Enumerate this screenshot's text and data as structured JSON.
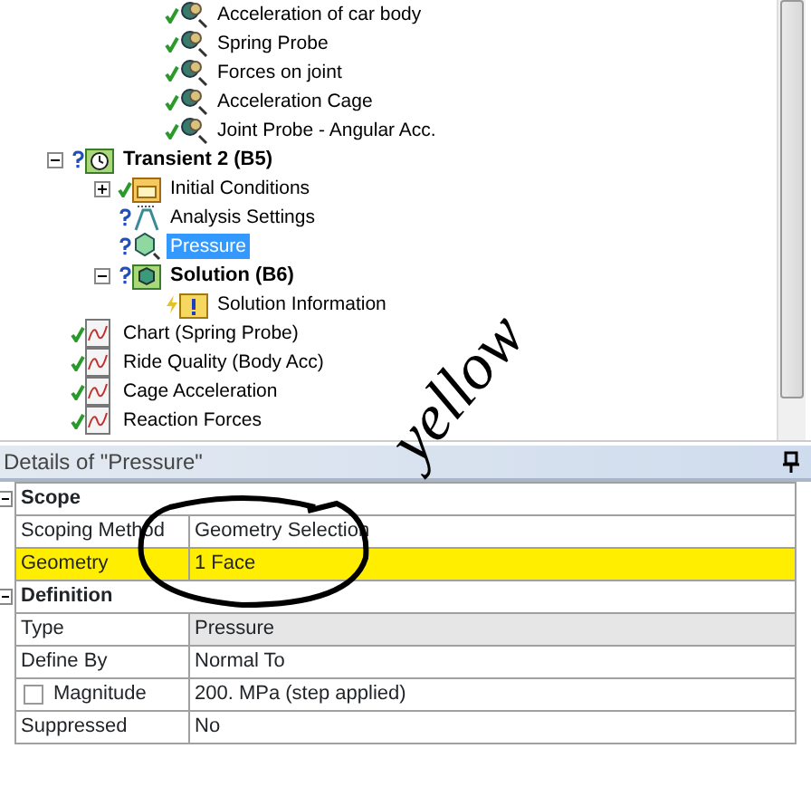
{
  "tree_upper_items": [
    {
      "label": "Acceleration of car body",
      "kind": "probe",
      "solved": true,
      "outdated": false
    },
    {
      "label": "Spring Probe",
      "kind": "probe",
      "solved": true,
      "outdated": false
    },
    {
      "label": "Forces on joint",
      "kind": "probe",
      "solved": true,
      "outdated": false
    },
    {
      "label": "Acceleration Cage",
      "kind": "probe",
      "solved": true,
      "outdated": false
    },
    {
      "label": "Joint Probe - Angular Acc.",
      "kind": "probe",
      "solved": true,
      "outdated": false
    }
  ],
  "tree": [
    {
      "label": "Transient 2 (B5)",
      "kind": "analysis",
      "solved": false,
      "outdated": false,
      "selected": false,
      "expanded": true,
      "children": [
        {
          "label": "Initial Conditions",
          "kind": "initial",
          "solved": true,
          "outdated": false,
          "selected": false,
          "expanded": false
        },
        {
          "label": "Analysis Settings",
          "kind": "settings",
          "solved": false,
          "outdated": false,
          "selected": false
        },
        {
          "label": "Pressure",
          "kind": "load",
          "solved": false,
          "outdated": false,
          "selected": true
        },
        {
          "label": "Solution (B6)",
          "kind": "solution",
          "solved": false,
          "outdated": false,
          "selected": false,
          "expanded": true,
          "children": [
            {
              "label": "Solution Information",
              "kind": "info",
              "solved": false,
              "outdated": true,
              "selected": false
            }
          ]
        }
      ]
    },
    {
      "label": "Chart (Spring Probe)",
      "kind": "chart",
      "solved": true,
      "outdated": false,
      "selected": false
    },
    {
      "label": "Ride Quality (Body Acc)",
      "kind": "chart",
      "solved": true,
      "outdated": false,
      "selected": false
    },
    {
      "label": "Cage Acceleration",
      "kind": "chart",
      "solved": true,
      "outdated": false,
      "selected": false
    },
    {
      "label": "Reaction Forces",
      "kind": "chart",
      "solved": true,
      "outdated": false,
      "selected": false
    }
  ],
  "details": {
    "title": "Details of \"Pressure\"",
    "sections": [
      {
        "label": "Scope",
        "expanded": true,
        "rows": [
          {
            "label": "Scoping Method",
            "value": "Geometry Selection",
            "highlighted": false,
            "readonly": false
          },
          {
            "label": "Geometry",
            "value": "1 Face",
            "highlighted": true,
            "readonly": false
          }
        ]
      },
      {
        "label": "Definition",
        "expanded": true,
        "rows": [
          {
            "label": "Type",
            "value": "Pressure",
            "highlighted": false,
            "readonly": true
          },
          {
            "label": "Define By",
            "value": "Normal To",
            "highlighted": false,
            "readonly": false
          },
          {
            "label": "Magnitude",
            "value": "200. MPa  (step applied)",
            "highlighted": false,
            "readonly": false,
            "checked": false
          },
          {
            "label": "Suppressed",
            "value": "No",
            "highlighted": false,
            "readonly": false
          }
        ]
      }
    ]
  },
  "annotation": {
    "text": "yellow"
  }
}
